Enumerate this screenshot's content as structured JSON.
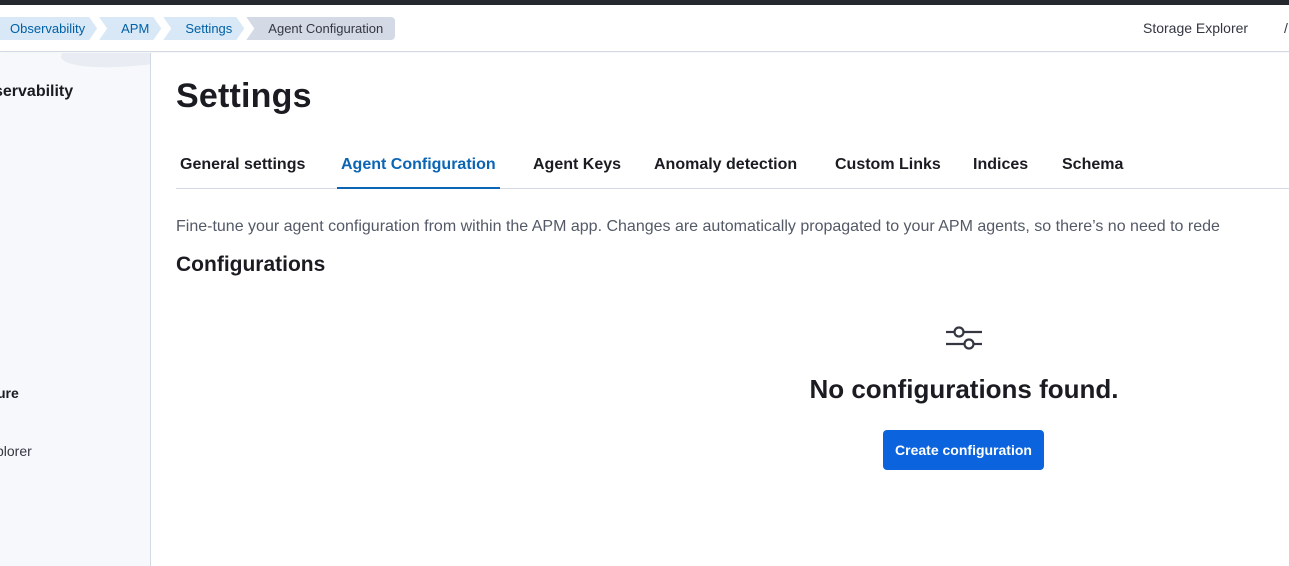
{
  "breadcrumbs": [
    "Observability",
    "APM",
    "Settings",
    "Agent Configuration"
  ],
  "header": {
    "right_link": "Storage Explorer",
    "right_trunc": "/"
  },
  "sidebar": {
    "title": "servability",
    "section": "ure",
    "item": "plorer"
  },
  "page": {
    "title": "Settings",
    "tabs": [
      {
        "label": "General settings",
        "active": false
      },
      {
        "label": "Agent Configuration",
        "active": true
      },
      {
        "label": "Agent Keys",
        "active": false
      },
      {
        "label": "Anomaly detection",
        "active": false
      },
      {
        "label": "Custom Links",
        "active": false
      },
      {
        "label": "Indices",
        "active": false
      },
      {
        "label": "Schema",
        "active": false
      }
    ],
    "description": "Fine-tune your agent configuration from within the APM app. Changes are automatically propagated to your APM agents, so there’s no need to rede",
    "section_title": "Configurations",
    "empty_state": {
      "icon": "sliders-icon",
      "title": "No configurations found.",
      "button": "Create configuration"
    }
  },
  "colors": {
    "accent": "#0b64dd",
    "active_tab": "#0b64b4",
    "breadcrumb_bg": "#d8e8f6"
  }
}
